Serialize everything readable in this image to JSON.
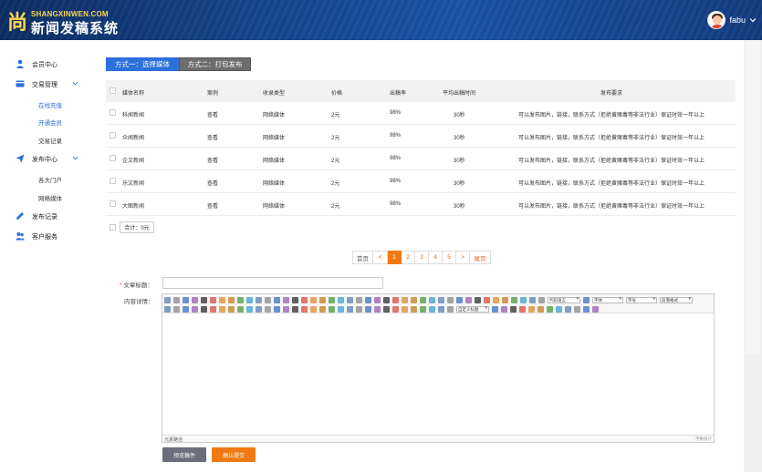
{
  "header": {
    "logo_char": "尚",
    "logo_domain": "SHANGXINWEN.COM",
    "logo_title": "新闻发稿系统",
    "username": "fabu"
  },
  "sidebar": {
    "items": [
      {
        "label": "会员中心",
        "icon": "user-icon"
      },
      {
        "label": "交易管理",
        "icon": "card-icon",
        "expanded": true,
        "children": [
          {
            "label": "在线充值",
            "active": true
          },
          {
            "label": "开通会员",
            "active": true
          },
          {
            "label": "交易记录",
            "active": false
          }
        ]
      },
      {
        "label": "发布中心",
        "icon": "send-icon",
        "expanded": true,
        "children": [
          {
            "label": "各大门户",
            "active": false
          },
          {
            "label": "网络媒体",
            "active": false
          }
        ]
      },
      {
        "label": "发布记录",
        "icon": "pen-icon"
      },
      {
        "label": "客户服务",
        "icon": "people-icon"
      }
    ]
  },
  "tabs": [
    {
      "label": "方式一：选择媒体",
      "active": true
    },
    {
      "label": "方式二：打包发布",
      "active": false
    }
  ],
  "table": {
    "headers": [
      "媒体名称",
      "案例",
      "收录类型",
      "价格",
      "出稿率",
      "平均出稿时间",
      "发布要求"
    ],
    "rows": [
      [
        "科闻新闻",
        "查看",
        "网络媒体",
        "2元",
        "98%",
        "30秒",
        "可以发布图片，链接，联系方式（拒绝黄赌毒等非法行业）保证时效一年以上"
      ],
      [
        "众闻新闻",
        "查看",
        "网络媒体",
        "2元",
        "98%",
        "30秒",
        "可以发布图片，链接，联系方式（拒绝黄赌毒等非法行业）保证时效一年以上"
      ],
      [
        "企文新闻",
        "查看",
        "网络媒体",
        "2元",
        "98%",
        "30秒",
        "可以发布图片，链接，联系方式（拒绝黄赌毒等非法行业）保证时效一年以上"
      ],
      [
        "乐文新闻",
        "查看",
        "网络媒体",
        "2元",
        "98%",
        "30秒",
        "可以发布图片，链接，联系方式（拒绝黄赌毒等非法行业）保证时效一年以上"
      ],
      [
        "大图新闻",
        "查看",
        "网络媒体",
        "2元",
        "98%",
        "30秒",
        "可以发布图片，链接，联系方式（拒绝黄赌毒等非法行业）保证时效一年以上"
      ]
    ],
    "total_label": "合计：0元"
  },
  "pager": {
    "first": "首页",
    "prev": "<",
    "pages": [
      "1",
      "2",
      "3",
      "4",
      "5"
    ],
    "current": "1",
    "next": ">",
    "last": "尾页"
  },
  "form": {
    "title_label": "文章标题：",
    "content_label": "内容详情：",
    "title_value": "",
    "editor_selects": [
      "代码语言",
      "字体",
      "字号",
      "段落格式",
      "自定义标题"
    ],
    "editor_path": "元素路径:",
    "editor_count": "字数统计",
    "preview_button": "预览稿件",
    "submit_button": "确认提交"
  },
  "colors": {
    "header": "#15468f",
    "primary_blue": "#2d6fdb",
    "accent_orange": "#f07a12",
    "tab_gray": "#6d6d6d",
    "preview_gray": "#6a6e7a"
  }
}
